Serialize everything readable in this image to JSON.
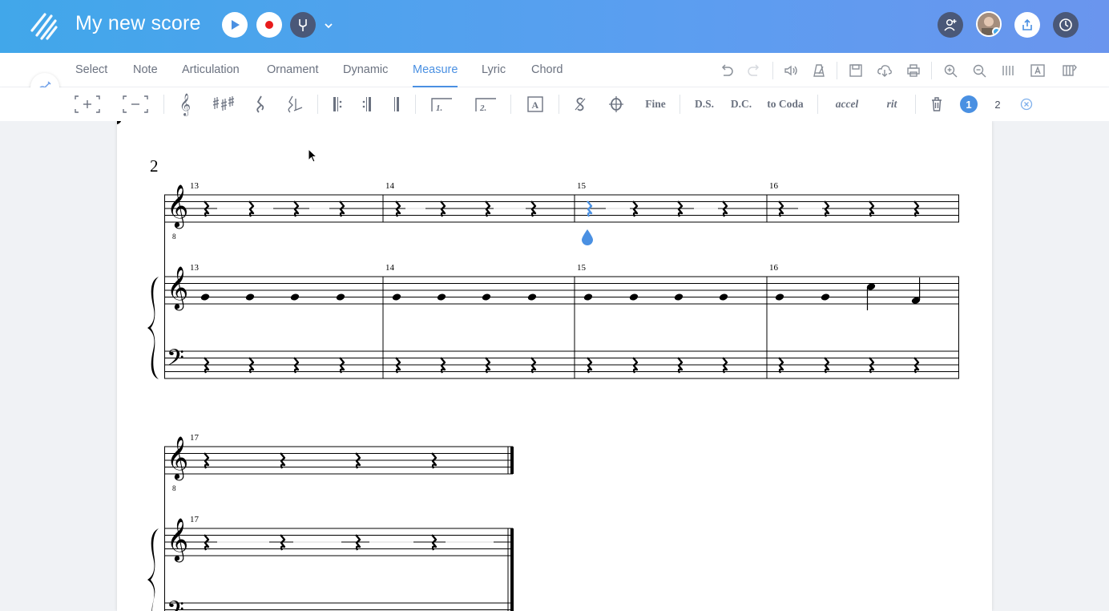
{
  "header": {
    "title": "My new score",
    "colors": {
      "gradient_start": "#41a7ea",
      "gradient_end": "#6a95ee",
      "dark_button": "#4a5878",
      "record": "#e81b1b"
    },
    "icons": [
      "logo-icon",
      "play-icon",
      "record-icon",
      "tuning-fork-icon",
      "chevron-down-icon",
      "add-collaborator-icon",
      "avatar",
      "share-icon",
      "history-icon"
    ]
  },
  "tabs": [
    {
      "label": "Select"
    },
    {
      "label": "Note"
    },
    {
      "label": "Articulation"
    },
    {
      "label": "Ornament"
    },
    {
      "label": "Dynamic"
    },
    {
      "label": "Measure",
      "active": true
    },
    {
      "label": "Lyric"
    },
    {
      "label": "Chord"
    }
  ],
  "tools": {
    "text_tools": {
      "fine": "Fine",
      "ds": "D.S.",
      "dc": "D.C.",
      "to_coda": "to Coda",
      "accel": "accel",
      "rit": "rit"
    },
    "pages": {
      "current": "1",
      "other": "2"
    },
    "icons": [
      "add-measure-icon",
      "remove-measure-icon",
      "clef-icon",
      "key-signature-icon",
      "time-signature-icon",
      "pickup-icon",
      "repeat-start-icon",
      "repeat-end-icon",
      "double-barline-icon",
      "ending-1-icon",
      "ending-2-icon",
      "text-box-icon",
      "segno-icon",
      "coda-icon",
      "delete-icon",
      "close-icon"
    ]
  },
  "score": {
    "page_number": "2",
    "system1": {
      "measures": [
        "13",
        "14",
        "15",
        "16"
      ]
    },
    "system2": {
      "measures": [
        "17"
      ]
    },
    "selection_color": "#4a90e2"
  }
}
